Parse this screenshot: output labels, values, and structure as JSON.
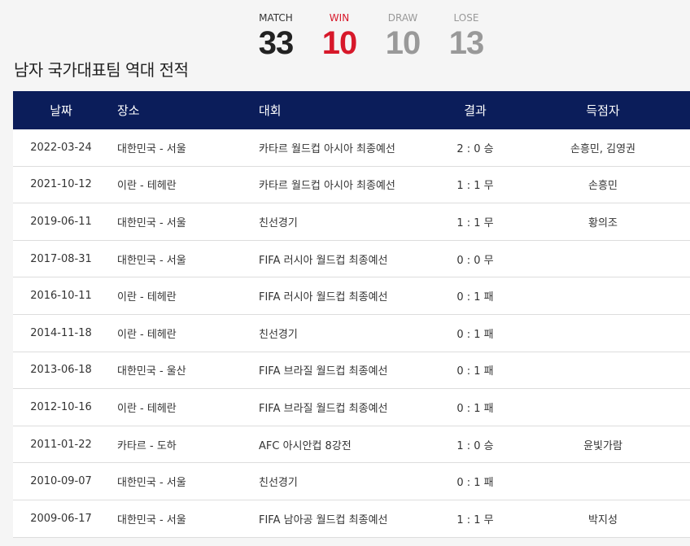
{
  "page": {
    "title": "남자 국가대표팀 역대 전적"
  },
  "stats": [
    {
      "key": "match",
      "label": "MATCH",
      "value": "33"
    },
    {
      "key": "win",
      "label": "WIN",
      "value": "10"
    },
    {
      "key": "draw",
      "label": "DRAW",
      "value": "10"
    },
    {
      "key": "lose",
      "label": "LOSE",
      "value": "13"
    }
  ],
  "colors": {
    "header_bg": "#0b1d5a",
    "win": "#d7182a",
    "muted": "#999999"
  },
  "table": {
    "headers": {
      "date": "날짜",
      "venue": "장소",
      "competition": "대회",
      "result": "결과",
      "scorers": "득점자"
    },
    "rows": [
      {
        "date": "2022-03-24",
        "venue": "대한민국 - 서울",
        "competition": "카타르 월드컵 아시아 최종예선",
        "result": "2 : 0 승",
        "scorers": "손흥민, 김영권"
      },
      {
        "date": "2021-10-12",
        "venue": "이란 - 테헤란",
        "competition": "카타르 월드컵 아시아 최종예선",
        "result": "1 : 1 무",
        "scorers": "손흥민"
      },
      {
        "date": "2019-06-11",
        "venue": "대한민국 - 서울",
        "competition": "친선경기",
        "result": "1 : 1 무",
        "scorers": "황의조"
      },
      {
        "date": "2017-08-31",
        "venue": "대한민국 - 서울",
        "competition": "FIFA 러시아 월드컵 최종예선",
        "result": "0 : 0 무",
        "scorers": ""
      },
      {
        "date": "2016-10-11",
        "venue": "이란 - 테헤란",
        "competition": "FIFA 러시아 월드컵 최종예선",
        "result": "0 : 1 패",
        "scorers": ""
      },
      {
        "date": "2014-11-18",
        "venue": "이란 - 테헤란",
        "competition": "친선경기",
        "result": "0 : 1 패",
        "scorers": ""
      },
      {
        "date": "2013-06-18",
        "venue": "대한민국 - 울산",
        "competition": "FIFA 브라질 월드컵 최종예선",
        "result": "0 : 1 패",
        "scorers": ""
      },
      {
        "date": "2012-10-16",
        "venue": "이란 - 테헤란",
        "competition": "FIFA 브라질 월드컵 최종예선",
        "result": "0 : 1 패",
        "scorers": ""
      },
      {
        "date": "2011-01-22",
        "venue": "카타르 - 도하",
        "competition": "AFC 아시안컵 8강전",
        "result": "1 : 0 승",
        "scorers": "윤빛가람"
      },
      {
        "date": "2010-09-07",
        "venue": "대한민국 - 서울",
        "competition": "친선경기",
        "result": "0 : 1 패",
        "scorers": ""
      },
      {
        "date": "2009-06-17",
        "venue": "대한민국 - 서울",
        "competition": "FIFA 남아공 월드컵 최종예선",
        "result": "1 : 1 무",
        "scorers": "박지성"
      }
    ]
  }
}
